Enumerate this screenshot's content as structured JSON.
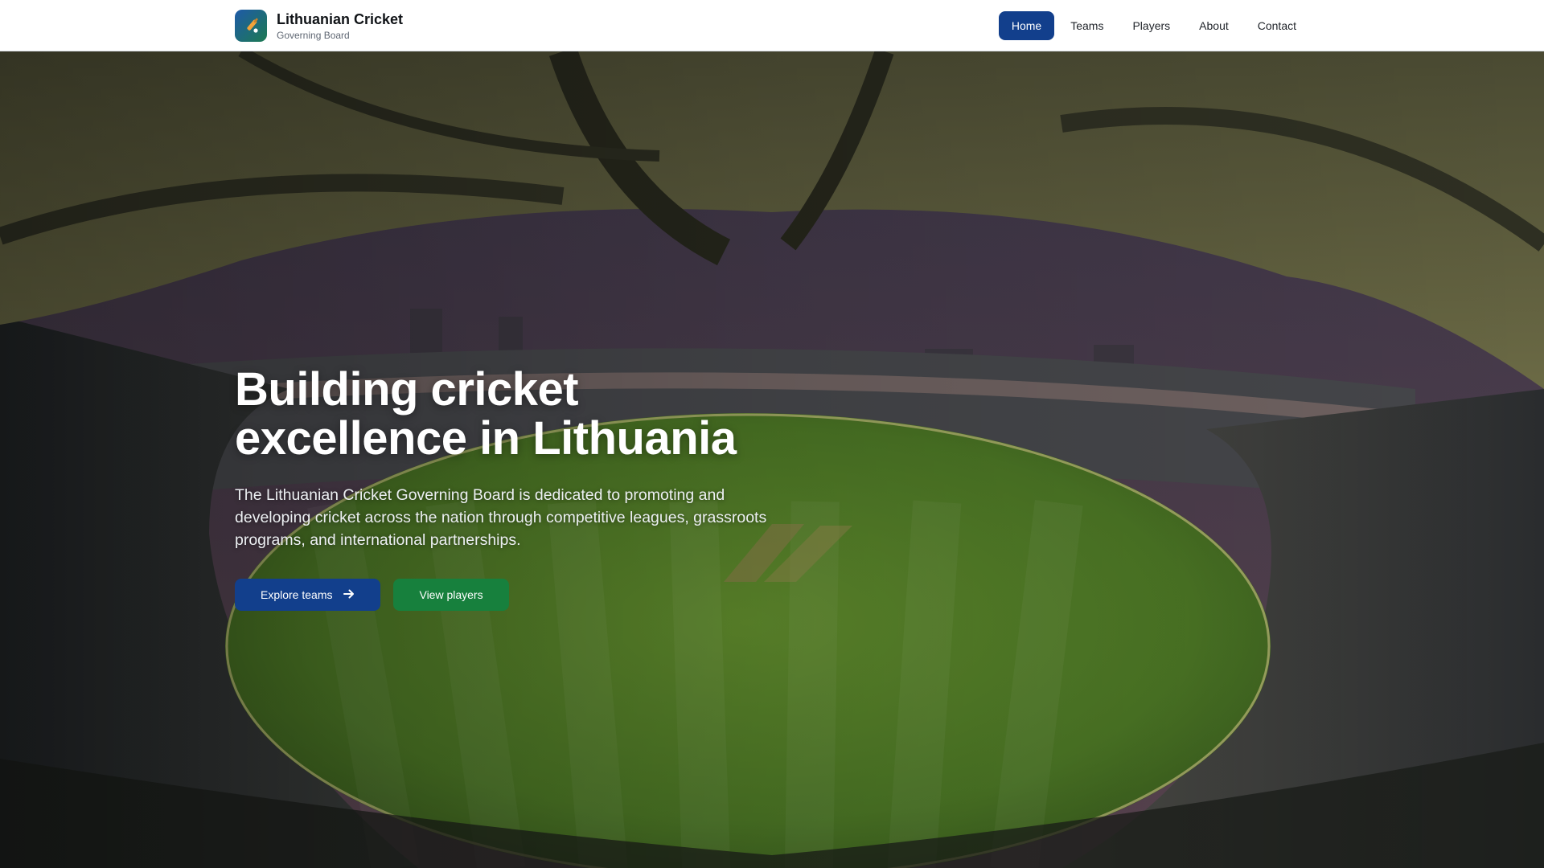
{
  "header": {
    "brand_title": "Lithuanian Cricket",
    "brand_subtitle": "Governing Board",
    "logo_icon": "cricket-bat-icon",
    "nav": [
      {
        "label": "Home",
        "active": true
      },
      {
        "label": "Teams",
        "active": false
      },
      {
        "label": "Players",
        "active": false
      },
      {
        "label": "About",
        "active": false
      },
      {
        "label": "Contact",
        "active": false
      }
    ]
  },
  "hero": {
    "background": "cricket-stadium-photo",
    "title": "Building cricket excellence in Lithuania",
    "description": "The Lithuanian Cricket Governing Board is dedicated to promoting and developing cricket across the nation through competitive leagues, grassroots programs, and international partnerships.",
    "primary_button": {
      "label": "Explore teams",
      "icon": "arrow-right-icon"
    },
    "secondary_button": {
      "label": "View players"
    }
  },
  "colors": {
    "primary": "#123f8c",
    "secondary": "#17803d",
    "header_bg": "#ffffff",
    "text_dark": "#111418"
  }
}
